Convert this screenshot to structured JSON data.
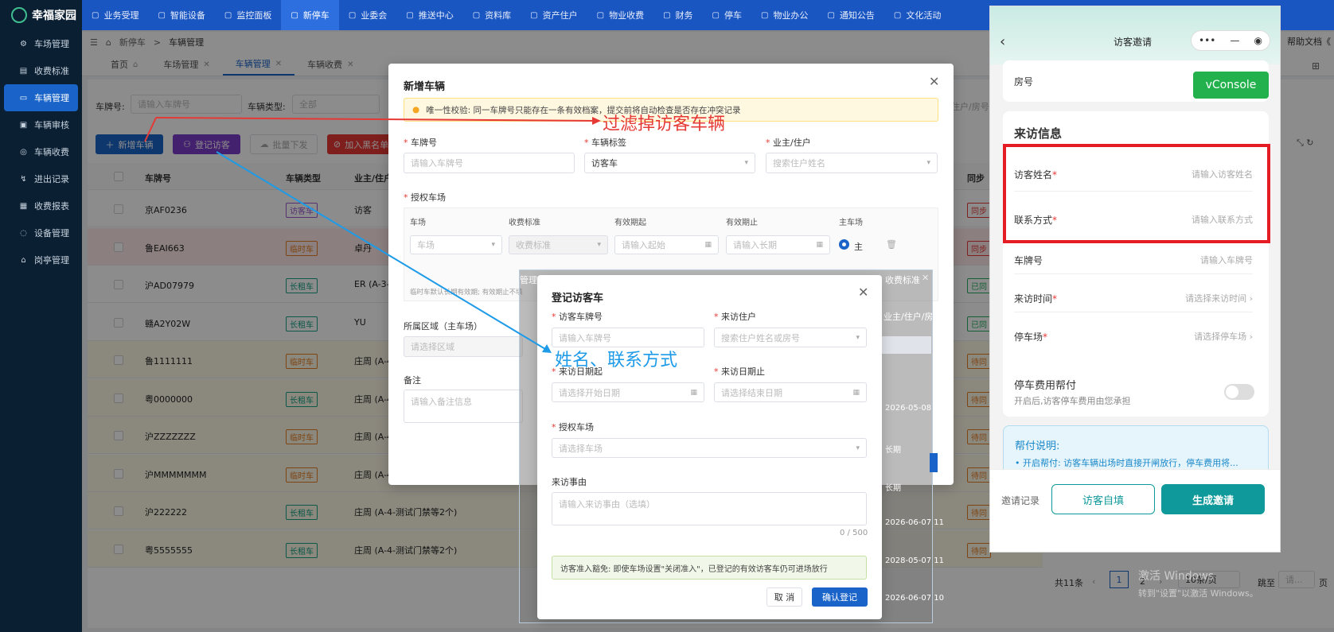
{
  "app": {
    "name": "幸福家园"
  },
  "sidebar": {
    "items": [
      {
        "label": "车场管理",
        "icon": "gear-icon"
      },
      {
        "label": "收费标准",
        "icon": "tag-icon"
      },
      {
        "label": "车辆管理",
        "icon": "car-icon",
        "active": true
      },
      {
        "label": "车辆审核",
        "icon": "audit-icon"
      },
      {
        "label": "车辆收费",
        "icon": "coin-icon"
      },
      {
        "label": "进出记录",
        "icon": "record-icon"
      },
      {
        "label": "收费报表",
        "icon": "report-icon"
      },
      {
        "label": "设备管理",
        "icon": "device-icon"
      },
      {
        "label": "岗亭管理",
        "icon": "booth-icon"
      }
    ]
  },
  "topnav": {
    "items": [
      "业务受理",
      "智能设备",
      "监控面板",
      "新停车",
      "业委会",
      "推送中心",
      "资料库",
      "资产住户",
      "物业收费",
      "财务",
      "停车",
      "物业办公",
      "通知公告",
      "文化活动"
    ],
    "active_index": 3,
    "help": "帮助文档《"
  },
  "breadcrumb": [
    "新停车",
    "车辆管理"
  ],
  "tabs": [
    {
      "label": "首页"
    },
    {
      "label": "车场管理"
    },
    {
      "label": "车辆管理",
      "active": true
    },
    {
      "label": "车辆收费"
    }
  ],
  "filters": {
    "plate_label": "车牌号:",
    "plate_ph": "请输入车牌号",
    "type_label": "车辆类型:",
    "type_value": "全部",
    "partial_right": "住户/房号"
  },
  "buttons": {
    "add": "新增车辆",
    "register": "登记访客",
    "batch": "批量下发",
    "blacklist": "加入黑名单"
  },
  "table": {
    "headers": [
      "车牌号",
      "车辆类型",
      "业主/住户",
      "同步"
    ],
    "rows": [
      {
        "plate": "京AF0236",
        "type": "访客车",
        "owner": "访客",
        "sync": "同步",
        "tag_color": "#9b59d0",
        "bg": "#ffffff",
        "sync_color": "#e53935"
      },
      {
        "plate": "鲁EAI663",
        "type": "临时车",
        "owner": "卓丹",
        "sync": "同步",
        "tag_color": "#e67e22",
        "bg": "#fde8e8",
        "sync_color": "#e53935"
      },
      {
        "plate": "沪AD07979",
        "type": "长租车",
        "owner": "ER (A-3-",
        "sync": "已同",
        "tag_color": "#16a085",
        "bg": "#ffffff",
        "sync_color": "#27ae60"
      },
      {
        "plate": "赣A2Y02W",
        "type": "长租车",
        "owner": "YU",
        "sync": "已同",
        "tag_color": "#16a085",
        "bg": "#ffffff",
        "sync_color": "#27ae60"
      },
      {
        "plate": "鲁1111111",
        "type": "临时车",
        "owner": "庄周 (A-4-",
        "sync": "待同",
        "tag_color": "#e67e22",
        "bg": "#fdf8e6",
        "sync_color": "#e67e22"
      },
      {
        "plate": "粤0000000",
        "type": "长租车",
        "owner": "庄周 (A-4-",
        "sync": "待同",
        "tag_color": "#16a085",
        "bg": "#fdf8e6",
        "sync_color": "#e67e22"
      },
      {
        "plate": "沪ZZZZZZZ",
        "type": "临时车",
        "owner": "庄周 (A-4-",
        "sync": "待同",
        "tag_color": "#e67e22",
        "bg": "#fdf8e6",
        "sync_color": "#e67e22"
      },
      {
        "plate": "沪MMMMMMM",
        "type": "临时车",
        "owner": "庄周 (A-4-",
        "sync": "待同",
        "tag_color": "#e67e22",
        "bg": "#fdf8e6",
        "sync_color": "#e67e22"
      },
      {
        "plate": "沪222222",
        "type": "长租车",
        "owner": "庄周 (A-4-测试门禁等2个)",
        "sync": "待同",
        "tag_color": "#16a085",
        "bg": "#fdf8e6",
        "sync_color": "#e67e22"
      },
      {
        "plate": "粤5555555",
        "type": "长租车",
        "owner": "庄周 (A-4-测试门禁等2个)",
        "sync": "待同",
        "tag_color": "#16a085",
        "bg": "#fdf8e6",
        "sync_color": "#e67e22"
      }
    ],
    "right_dates": [
      "2026-05-08 11",
      "长期",
      "长期",
      "2026-06-07 11",
      "2028-05-07 11",
      "2026-06-07 11",
      "2026-06-07 10"
    ]
  },
  "pagination": {
    "total": "共11条",
    "page": "1",
    "next_page": "2",
    "page_size": "10条/页",
    "jump": "跳至",
    "jump_ph": "请...",
    "unit": "页"
  },
  "watermark": {
    "lines": [
      "激活 Windows",
      "转到\"设置\"以激活 Windows。"
    ]
  },
  "modal_add": {
    "title": "新增车辆",
    "warning": "唯一性校验: 同一车牌号只能存在一条有效档案，提交前将自动检查是否存在冲突记录",
    "plate_label": "车牌号",
    "plate_ph": "请输入车牌号",
    "tag_label": "车辆标签",
    "tag_value": "访客车",
    "owner_label": "业主/住户",
    "owner_ph": "搜索住户姓名",
    "lot_label": "授权车场",
    "sub_headers": [
      "车场",
      "收费标准",
      "有效期起",
      "有效期止",
      "主车场"
    ],
    "lot_ph": "车场",
    "fee_ph": "收费标准",
    "start_ph": "请输入起始",
    "end_ph": "请输入长期",
    "main": "主",
    "hint": "临时车默认长期有效期; 有效期止不填",
    "area_label": "所属区域（主车场）",
    "area_ph": "请选择区域",
    "remark_label": "备注",
    "remark_ph": "请输入备注信息",
    "partial_manage": "管理",
    "partial_fee": "收费标准",
    "partial_owner": "业主/住户/房号:"
  },
  "modal_visitor": {
    "title": "登记访客车",
    "plate_label": "访客车牌号",
    "plate_ph": "请输入车牌号",
    "resident_label": "来访住户",
    "resident_ph": "搜索住户姓名或房号",
    "start_label": "来访日期起",
    "start_ph": "请选择开始日期",
    "end_label": "来访日期止",
    "end_ph": "请选择结束日期",
    "lot_label": "授权车场",
    "lot_ph": "请选择车场",
    "reason_label": "来访事由",
    "reason_ph": "请输入来访事由（选填）",
    "counter": "0 / 500",
    "notice": "访客准入豁免: 即使车场设置\"关闭准入\"，已登记的有效访客车仍可进场放行",
    "cancel": "取 消",
    "confirm": "确认登记"
  },
  "annotations": {
    "filter_note": "过滤掉访客车辆",
    "fields_note": "姓名、联系方式",
    "red": "#e53935",
    "blue": "#1e9be8"
  },
  "phone": {
    "title": "访客邀请",
    "room_label": "房号",
    "vconsole": "vConsole",
    "section": "来访信息",
    "name_label": "访客姓名",
    "name_ph": "请输入访客姓名",
    "phone_label": "联系方式",
    "phone_ph": "请输入联系方式",
    "plate_label": "车牌号",
    "plate_ph": "请输入车牌号",
    "time_label": "来访时间",
    "time_ph": "请选择来访时间",
    "lot_label": "停车场",
    "lot_ph": "请选择停车场",
    "fee_title": "停车费用帮付",
    "fee_desc": "开启后,访客停车费用由您承担",
    "help_title": "帮付说明:",
    "help_text": "• 开启帮付: 访客车辆出场时直接开闸放行，停车费用将...",
    "records": "邀请记录",
    "self_fill": "访客自填",
    "generate": "生成邀请",
    "teal": "#10999a"
  }
}
